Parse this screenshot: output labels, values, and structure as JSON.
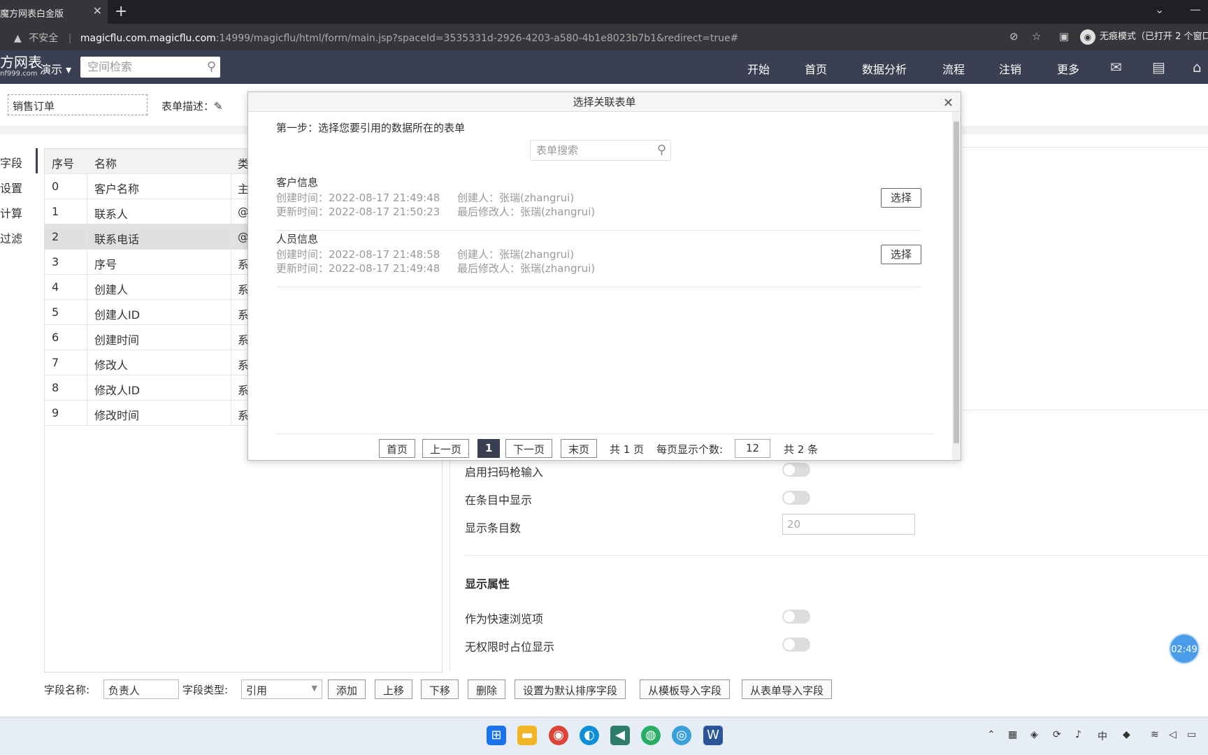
{
  "browser": {
    "tab_title": "魔方网表白金版",
    "tab_close": "✕",
    "new_tab": "+",
    "insecure_label": "不安全",
    "url_host": "magicflu.com.magicflu.com",
    "url_path": ":14999/magicflu/html/form/main.jsp?spaceId=3535331d-2926-4203-a580-4b1e8023b7b1&redirect=true#",
    "incognito_label": "无痕模式（已打开 2 个窗口）"
  },
  "header": {
    "logo_main": "方网表",
    "logo_sub": "nf999.com",
    "space_label": "演示 ▾",
    "search_placeholder": "空间检索",
    "nav": [
      "开始",
      "首页",
      "数据分析",
      "流程",
      "注销",
      "更多"
    ]
  },
  "form": {
    "name_value": "销售订单",
    "desc_label": "表单描述："
  },
  "left_nav": [
    "字段",
    "设置",
    "计算",
    "过滤"
  ],
  "field_table": {
    "headers": [
      "序号",
      "名称",
      "类"
    ],
    "rows": [
      {
        "idx": "0",
        "name": "客户名称",
        "type": "主"
      },
      {
        "idx": "1",
        "name": "联系人",
        "type": "@"
      },
      {
        "idx": "2",
        "name": "联系电话",
        "type": "@"
      },
      {
        "idx": "3",
        "name": "序号",
        "type": "系"
      },
      {
        "idx": "4",
        "name": "创建人",
        "type": "系"
      },
      {
        "idx": "5",
        "name": "创建人ID",
        "type": "系"
      },
      {
        "idx": "6",
        "name": "创建时间",
        "type": "系"
      },
      {
        "idx": "7",
        "name": "修改人",
        "type": "系"
      },
      {
        "idx": "8",
        "name": "修改人ID",
        "type": "系"
      },
      {
        "idx": "9",
        "name": "修改时间",
        "type": "系"
      }
    ]
  },
  "properties": {
    "scan_input": "启用扫码枪输入",
    "show_in_items": "在条目中显示",
    "item_count_label": "显示条目数",
    "item_count_placeholder": "20",
    "display_section": "显示属性",
    "quick_browse": "作为快速浏览项",
    "placeholder_no_perm": "无权限时占位显示"
  },
  "bottom_bar": {
    "field_name_label": "字段名称:",
    "field_name_value": "负责人",
    "field_type_label": "字段类型:",
    "field_type_value": "引用",
    "buttons": [
      "添加",
      "上移",
      "下移",
      "删除",
      "设置为默认排序字段",
      "从模板导入字段",
      "从表单导入字段"
    ]
  },
  "timer": "02:49",
  "modal": {
    "title": "选择关联表单",
    "close": "✕",
    "step": "第一步：选择您要引用的数据所在的表单",
    "search_placeholder": "表单搜索",
    "items": [
      {
        "name": "客户信息",
        "created_label": "创建时间：",
        "created": "2022-08-17 21:49:48",
        "creator_label": "创建人：",
        "creator": "张瑞(zhangrui)",
        "updated_label": "更新时间：",
        "updated": "2022-08-17 21:50:23",
        "modifier_label": "最后修改人：",
        "modifier": "张瑞(zhangrui)",
        "select": "选择"
      },
      {
        "name": "人员信息",
        "created_label": "创建时间：",
        "created": "2022-08-17 21:48:58",
        "creator_label": "创建人：",
        "creator": "张瑞(zhangrui)",
        "updated_label": "更新时间：",
        "updated": "2022-08-17 21:49:48",
        "modifier_label": "最后修改人：",
        "modifier": "张瑞(zhangrui)",
        "select": "选择"
      }
    ],
    "pager": {
      "first": "首页",
      "prev": "上一页",
      "current": "1",
      "next": "下一页",
      "last": "末页",
      "total_pages": "共 1 页",
      "per_page_label": "每页显示个数:",
      "per_page_value": "12",
      "total_items": "共 2 条"
    }
  },
  "colors": {
    "header_bg": "#3a3f51",
    "accent": "#3a3f51",
    "timer_bg": "#4a9be8"
  }
}
